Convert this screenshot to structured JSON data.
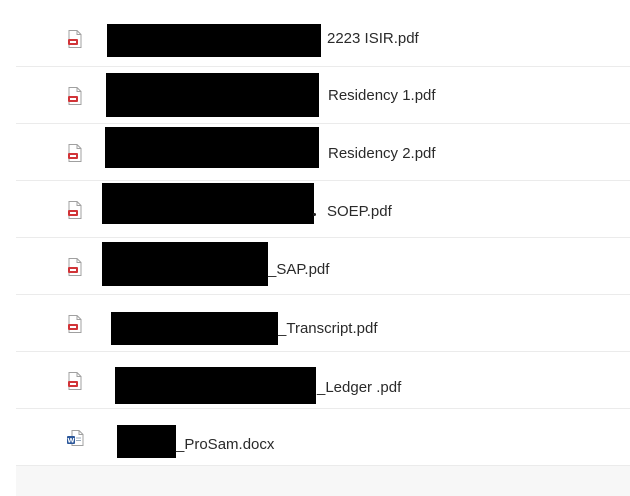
{
  "files": [
    {
      "name": "2223 ISIR.pdf",
      "type": "pdf",
      "icon": "pdf-file-icon"
    },
    {
      "name": "Residency 1.pdf",
      "type": "pdf",
      "icon": "pdf-file-icon"
    },
    {
      "name": "Residency 2.pdf",
      "type": "pdf",
      "icon": "pdf-file-icon"
    },
    {
      "name": "SOEP.pdf",
      "type": "pdf",
      "icon": "pdf-file-icon"
    },
    {
      "name": "_SAP.pdf",
      "type": "pdf",
      "icon": "pdf-file-icon"
    },
    {
      "name": "_Transcript.pdf",
      "type": "pdf",
      "icon": "pdf-file-icon"
    },
    {
      "name": "_Ledger .pdf",
      "type": "pdf",
      "icon": "pdf-file-icon"
    },
    {
      "name": "_ProSam.docx",
      "type": "docx",
      "icon": "word-file-icon"
    }
  ],
  "colors": {
    "pdf_icon": "#d13438",
    "word_icon": "#2b579a",
    "divider": "#ebebeb"
  }
}
